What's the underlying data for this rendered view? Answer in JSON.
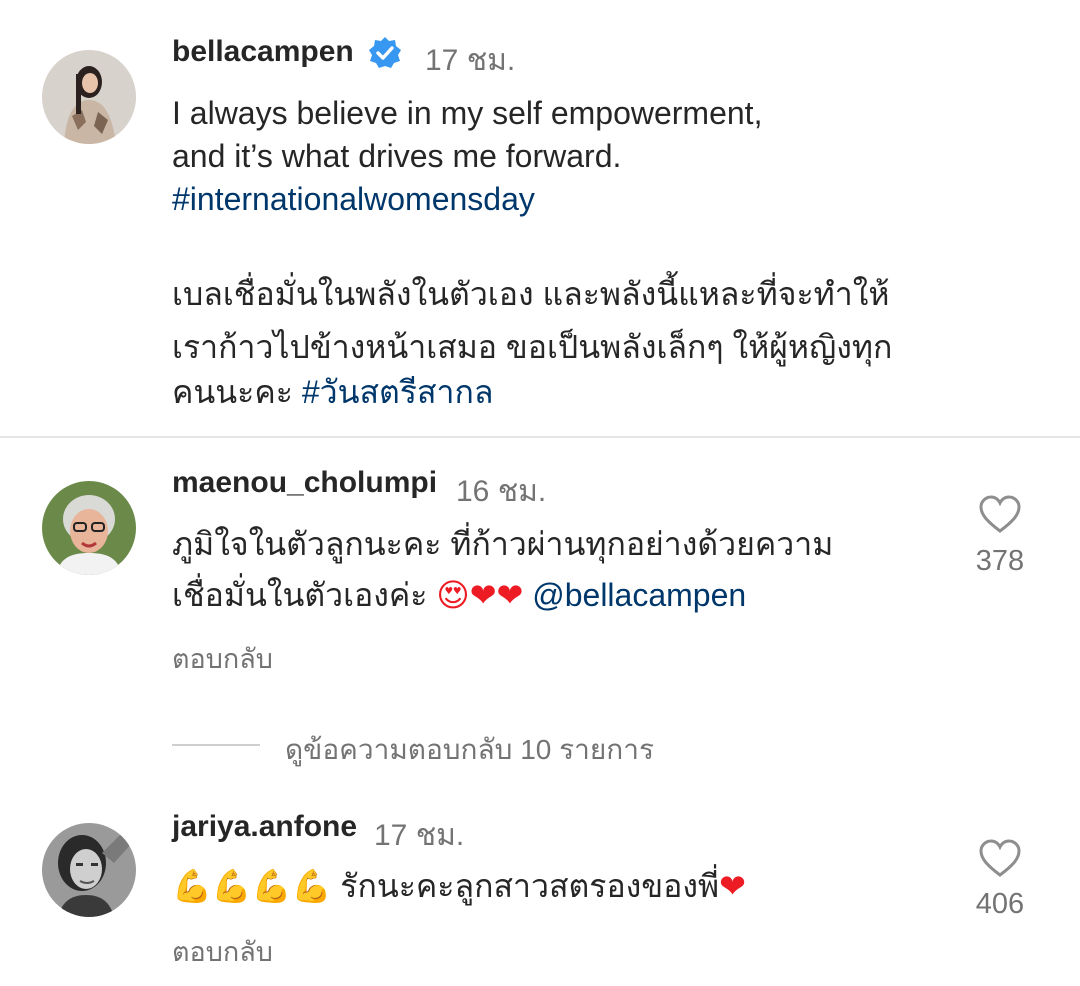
{
  "post": {
    "username": "bellacampen",
    "time": "17 ชม.",
    "caption_en_line1": "I always believe in my self empowerment,",
    "caption_en_line2": "and it’s what drives me forward.",
    "hashtag_en": "#internationalwomensday",
    "caption_th_line1": "เบลเชื่อมั่นในพลังในตัวเอง และพลังนี้แหละที่จะทำให้",
    "caption_th_line2": "เราก้าวไปข้างหน้าเสมอ ขอเป็นพลังเล็กๆ ให้ผู้หญิงทุก",
    "caption_th_line3": "คนนะคะ",
    "hashtag_th": "#วันสตรีสากล"
  },
  "comments": [
    {
      "username": "maenou_cholumpi",
      "time": "16 ชม.",
      "text_line1": "ภูมิใจในตัวลูกนะคะ ที่ก้าวผ่านทุกอย่างด้วยความ",
      "text_line2": "เชื่อมั่นในตัวเองค่ะ",
      "emojis": "😍❤❤",
      "mention": "@bellacampen",
      "likes": "378",
      "reply_label": "ตอบกลับ"
    },
    {
      "username": "jariya.anfone",
      "time": "17 ชม.",
      "emojis": "💪💪💪💪",
      "text": "รักนะคะลูกสาวสตรองของพี่",
      "heart_emoji": "❤",
      "likes": "406",
      "reply_label": "ตอบกลับ"
    }
  ],
  "view_replies": "ดูข้อความตอบกลับ 10 รายการ",
  "colors": {
    "link": "#00376b",
    "verified": "#3897f0",
    "secondary": "#737373",
    "heart_red": "#ed1c24"
  }
}
